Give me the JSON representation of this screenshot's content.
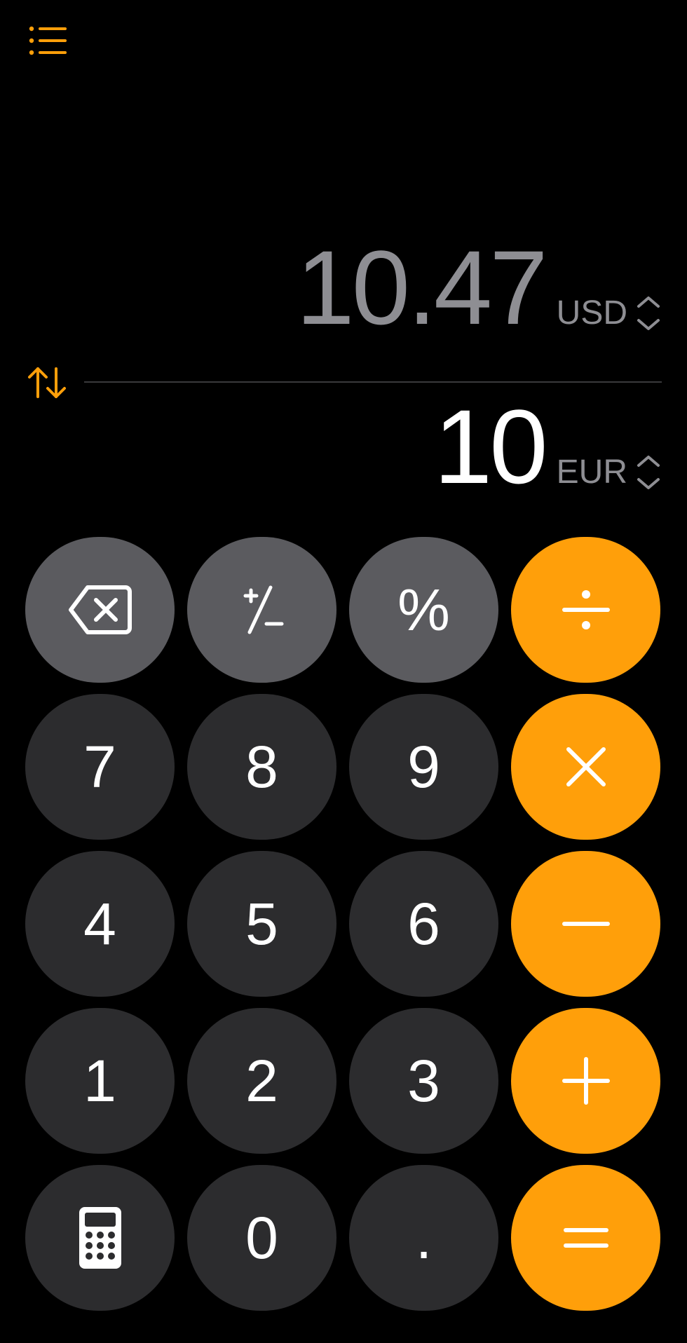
{
  "header": {
    "menu_icon": "list-bullet-icon"
  },
  "converter": {
    "top": {
      "value": "10.47",
      "currency": "USD"
    },
    "bottom": {
      "value": "10",
      "currency": "EUR"
    },
    "swap_icon": "swap-arrows-icon",
    "selector_icon": "chevron-up-down-icon"
  },
  "keypad": {
    "rows": [
      [
        {
          "id": "backspace",
          "type": "fn",
          "icon": "backspace-icon"
        },
        {
          "id": "plus-minus",
          "type": "fn",
          "icon": "plus-minus-icon"
        },
        {
          "id": "percent",
          "type": "fn",
          "label": "%"
        },
        {
          "id": "divide",
          "type": "op",
          "icon": "divide-icon"
        }
      ],
      [
        {
          "id": "7",
          "type": "num",
          "label": "7"
        },
        {
          "id": "8",
          "type": "num",
          "label": "8"
        },
        {
          "id": "9",
          "type": "num",
          "label": "9"
        },
        {
          "id": "multiply",
          "type": "op",
          "icon": "multiply-icon"
        }
      ],
      [
        {
          "id": "4",
          "type": "num",
          "label": "4"
        },
        {
          "id": "5",
          "type": "num",
          "label": "5"
        },
        {
          "id": "6",
          "type": "num",
          "label": "6"
        },
        {
          "id": "minus",
          "type": "op",
          "icon": "minus-icon"
        }
      ],
      [
        {
          "id": "1",
          "type": "num",
          "label": "1"
        },
        {
          "id": "2",
          "type": "num",
          "label": "2"
        },
        {
          "id": "3",
          "type": "num",
          "label": "3"
        },
        {
          "id": "plus",
          "type": "op",
          "icon": "plus-icon"
        }
      ],
      [
        {
          "id": "calculator",
          "type": "num",
          "icon": "calculator-icon"
        },
        {
          "id": "0",
          "type": "num",
          "label": "0"
        },
        {
          "id": "decimal",
          "type": "num",
          "label": "."
        },
        {
          "id": "equals",
          "type": "op",
          "icon": "equals-icon"
        }
      ]
    ]
  },
  "colors": {
    "accent": "#ff9f0a",
    "function_key": "#5b5b5f",
    "number_key": "#2c2c2e",
    "secondary_text": "#8e8e93",
    "background": "#000000"
  }
}
